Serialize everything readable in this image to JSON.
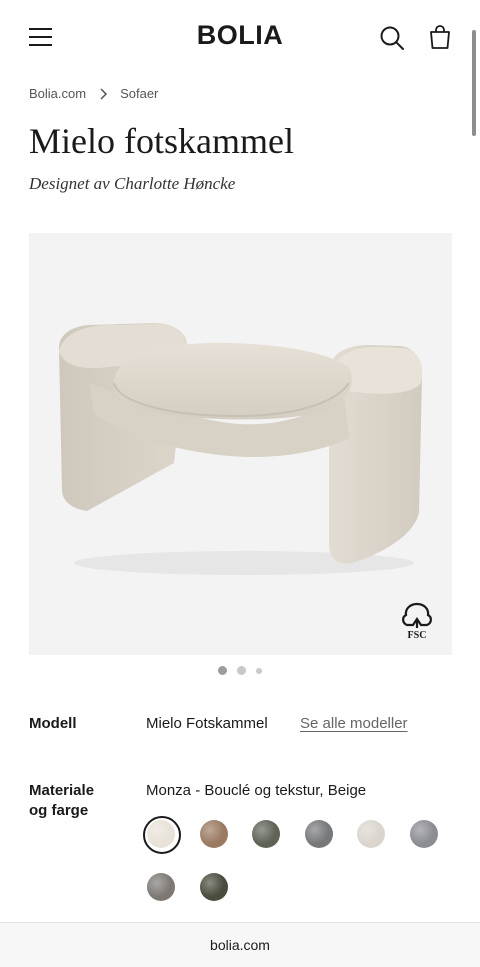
{
  "header": {
    "logo": "BOLIA",
    "icons": {
      "menu": "hamburger-menu-icon",
      "search": "search-icon",
      "cart": "shopping-bag-icon"
    }
  },
  "breadcrumb": {
    "items": [
      "Bolia.com",
      "Sofaer"
    ]
  },
  "product": {
    "title": "Mielo fotskammel",
    "designer": "Designet av Charlotte Høncke",
    "badge": "FSC"
  },
  "gallery": {
    "slides": 3,
    "active": 1
  },
  "model": {
    "label": "Modell",
    "value": "Mielo Fotskammel",
    "link": "Se alle modeller"
  },
  "material": {
    "label_line1": "Materiale",
    "label_line2": "og farge",
    "value": "Monza - Bouclé og tekstur, Beige",
    "swatch_colors": [
      "#e8e2d8",
      "#9a7a62",
      "#5e6356",
      "#77787a",
      "#dad6ce",
      "#8c8c94",
      "#7d7874",
      "#4a4c3e"
    ],
    "selected_index": 0
  },
  "browser": {
    "url": "bolia.com"
  }
}
